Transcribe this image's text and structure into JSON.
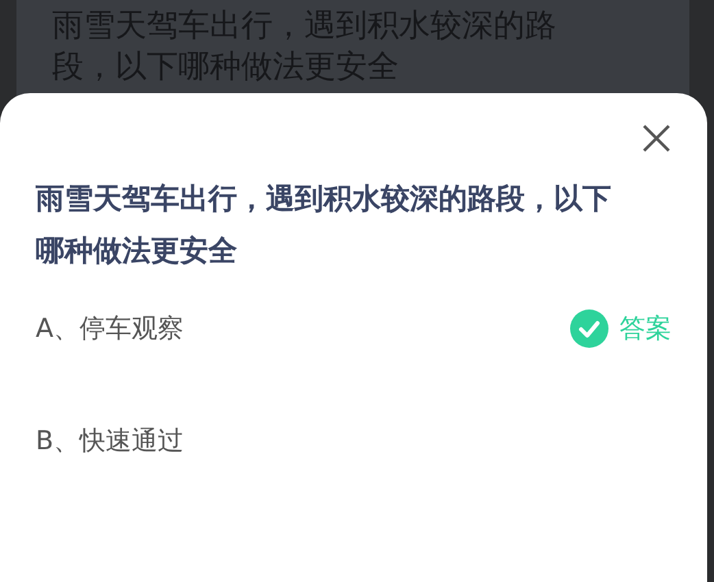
{
  "background_question": "雨雪天驾车出行，遇到积水较深的路段，以下哪种做法更安全",
  "dialog": {
    "question": "雨雪天驾车出行，遇到积水较深的路段，以下哪种做法更安全",
    "options": [
      {
        "label": "A、停车观察",
        "correct": true,
        "answer_tag": "答案"
      },
      {
        "label": "B、快速通过",
        "correct": false
      }
    ]
  }
}
